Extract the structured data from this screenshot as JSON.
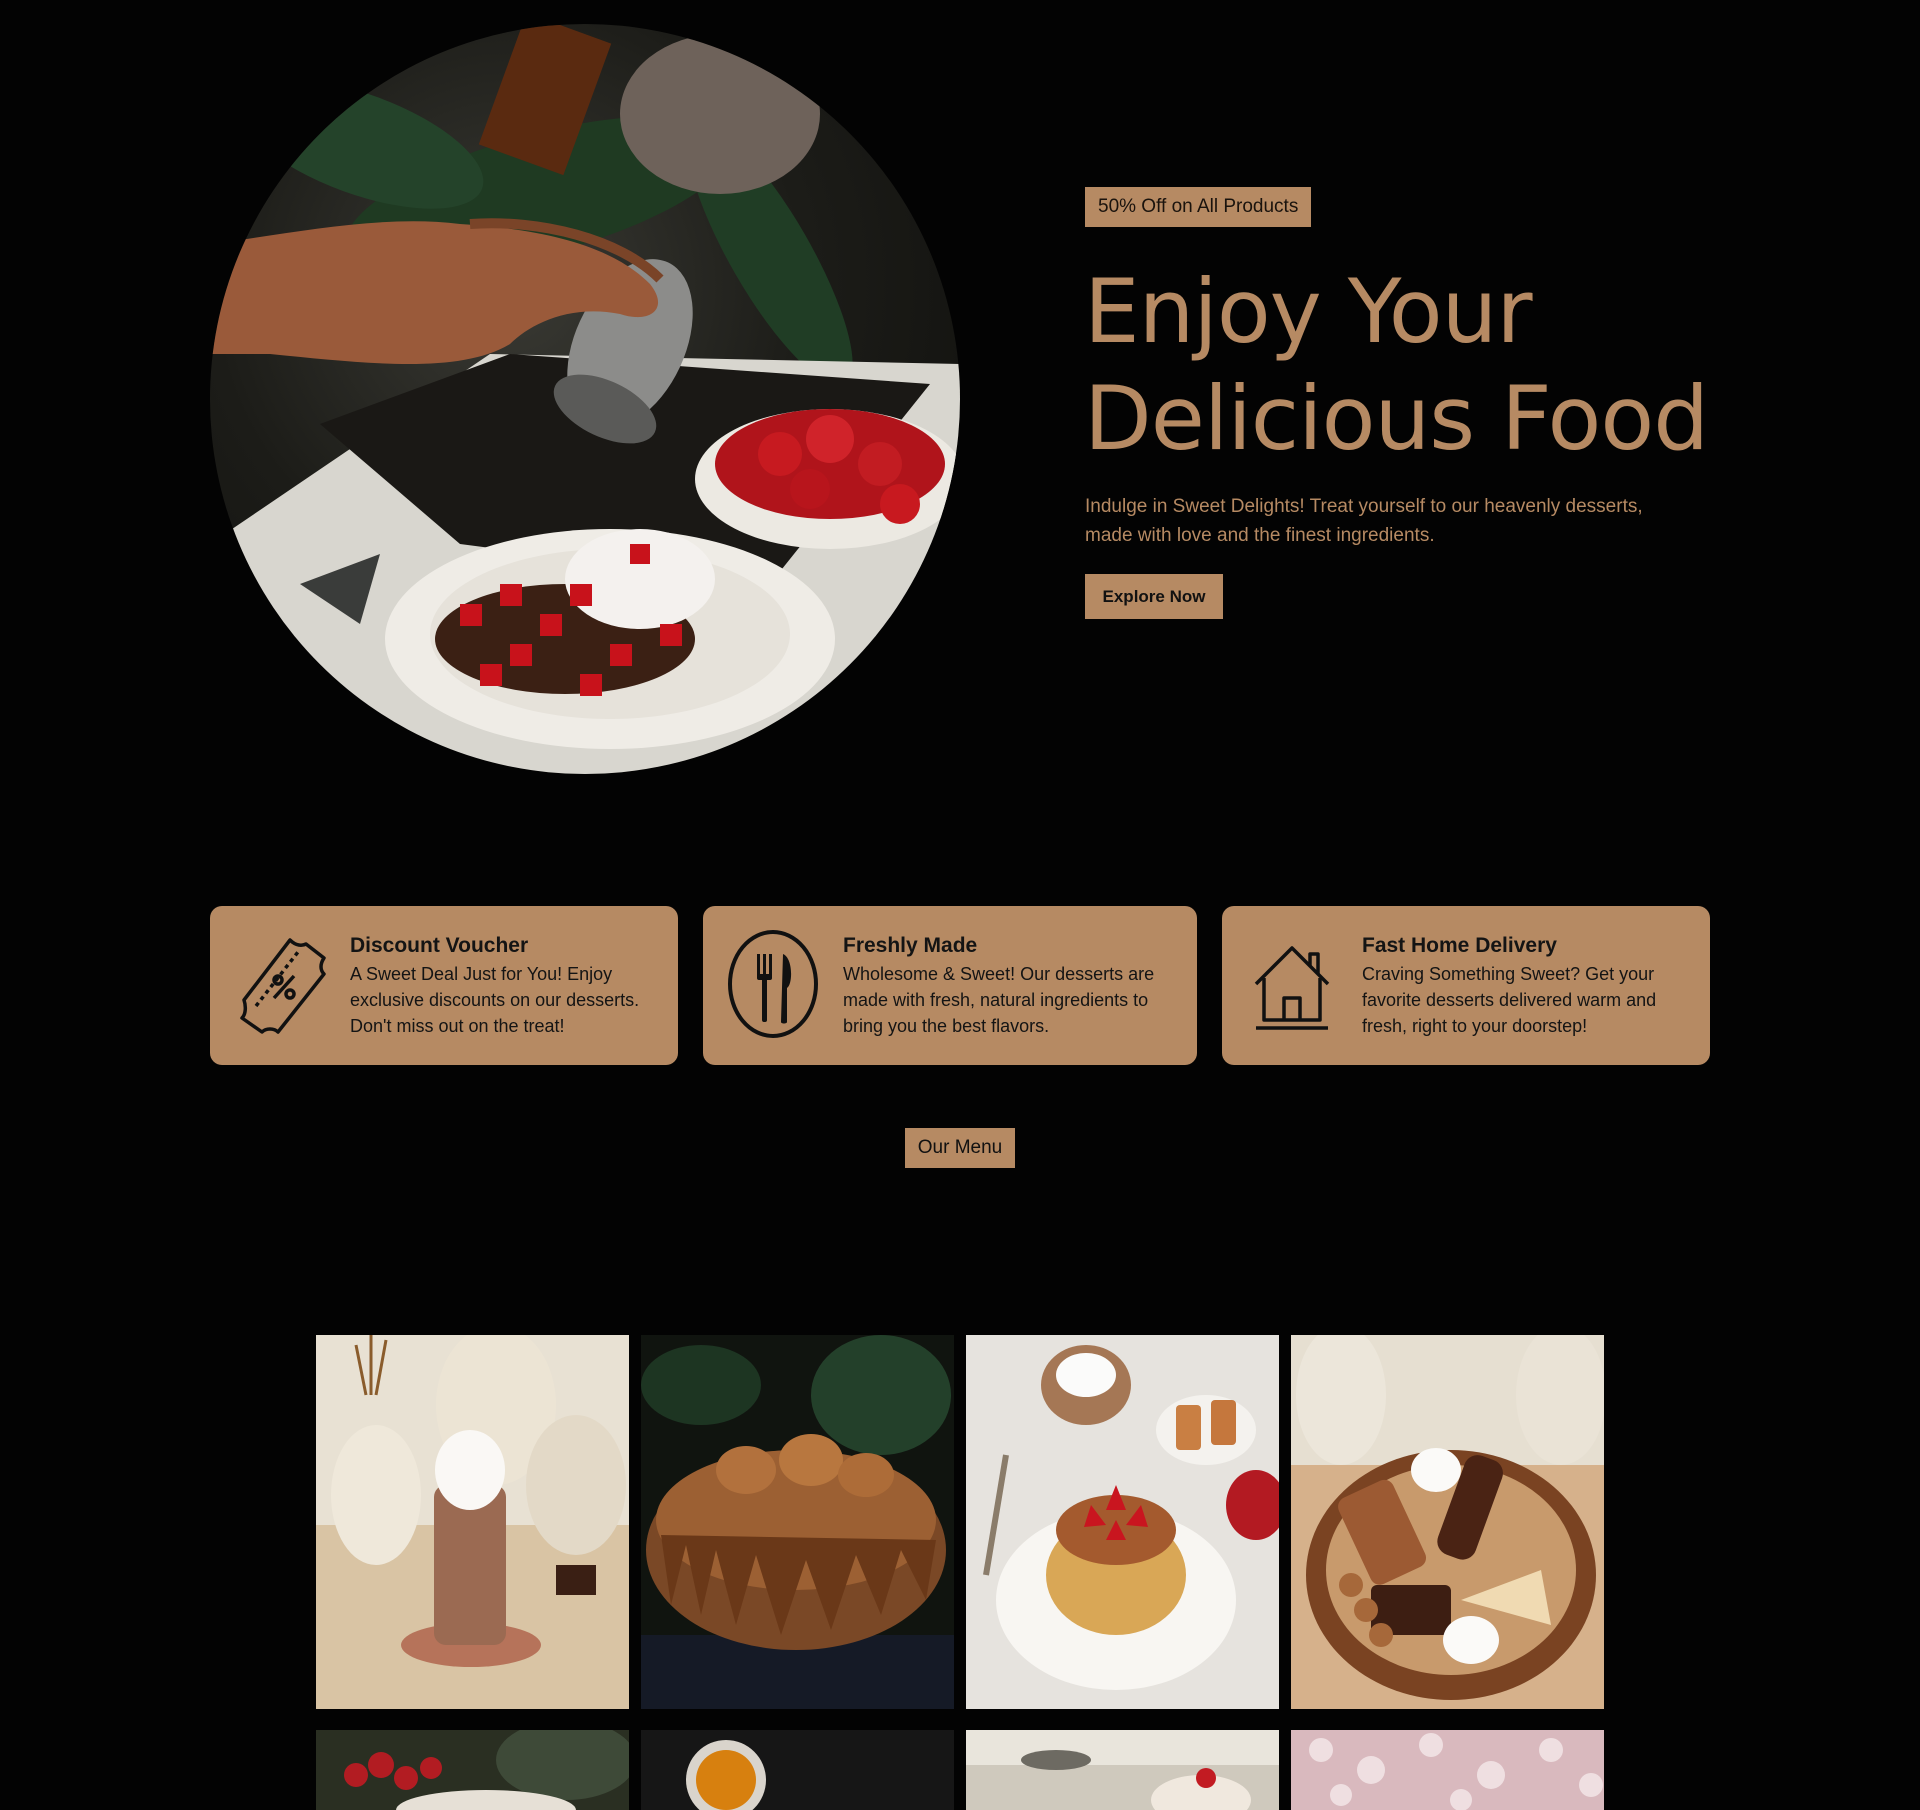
{
  "hero": {
    "badge": "50% Off on All Products",
    "title_line1": "Enjoy Your",
    "title_line2": "Delicious Food",
    "subtitle": "Indulge in Sweet Delights! Treat yourself to our heavenly desserts, made with love and the finest ingredients.",
    "cta_label": "Explore Now"
  },
  "features": [
    {
      "icon": "voucher-icon",
      "title": "Discount Voucher",
      "text": "A Sweet Deal Just for You! Enjoy exclusive discounts on our desserts. Don't miss out on the treat!"
    },
    {
      "icon": "fork-knife-icon",
      "title": "Freshly Made",
      "text": "Wholesome & Sweet! Our desserts are made with fresh, natural ingredients to bring you the best flavors."
    },
    {
      "icon": "home-icon",
      "title": "Fast Home Delivery",
      "text": "Craving Something Sweet? Get your favorite desserts delivered warm and fresh, right to your doorstep!"
    }
  ],
  "menu_label": "Our Menu",
  "colors": {
    "background": "#030303",
    "accent": "#b68a63",
    "text_dark": "#141414"
  }
}
